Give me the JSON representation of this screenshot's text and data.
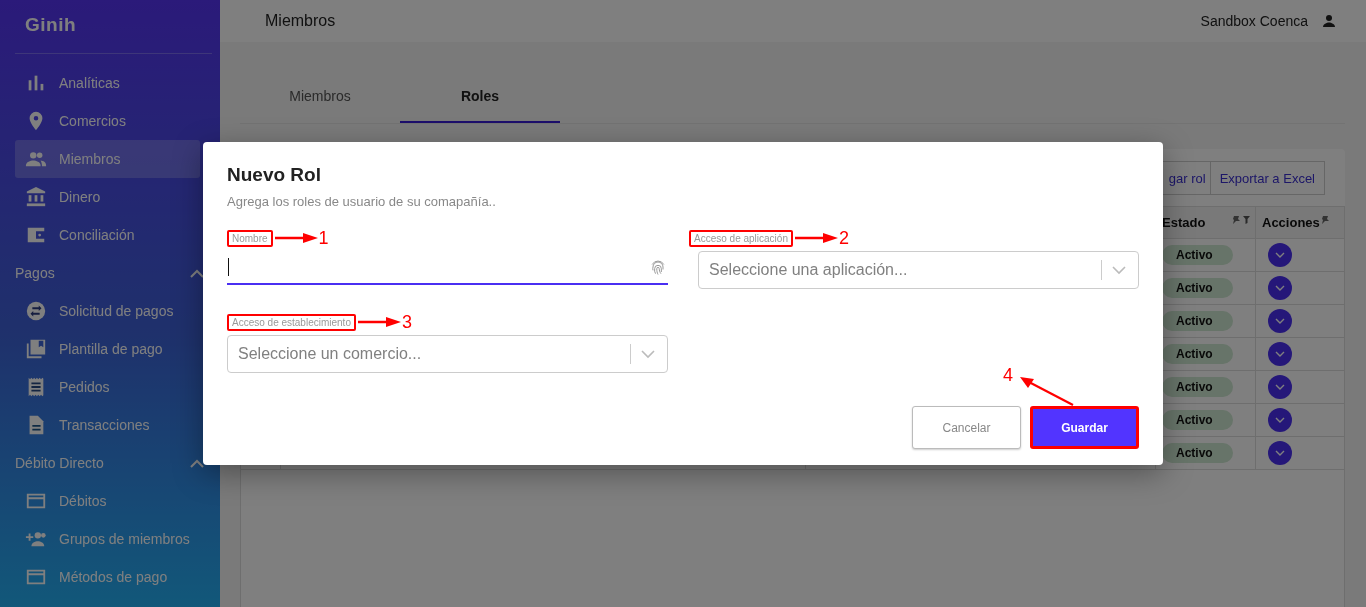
{
  "sidebar": {
    "logo": "Ginih",
    "groups": [
      {
        "items": [
          {
            "label": "Analíticas",
            "selected": false
          },
          {
            "label": "Comercios",
            "selected": false
          },
          {
            "label": "Miembros",
            "selected": true
          },
          {
            "label": "Dinero",
            "selected": false
          },
          {
            "label": "Conciliación",
            "selected": false
          }
        ]
      },
      {
        "title": "Pagos",
        "expanded": true,
        "items": [
          {
            "label": "Solicitud de pagos",
            "selected": false
          },
          {
            "label": "Plantilla de pago",
            "selected": false
          },
          {
            "label": "Pedidos",
            "selected": false
          },
          {
            "label": "Transacciones",
            "selected": false
          }
        ]
      },
      {
        "title": "Débito Directo",
        "expanded": true,
        "items": [
          {
            "label": "Débitos",
            "selected": false
          },
          {
            "label": "Grupos de miembros",
            "selected": false
          },
          {
            "label": "Métodos de pago",
            "selected": false
          }
        ]
      }
    ]
  },
  "header": {
    "title": "Miembros",
    "user": "Sandbox Coenca"
  },
  "tabs": [
    {
      "label": "Miembros",
      "selected": false
    },
    {
      "label": "Roles",
      "selected": true
    }
  ],
  "toolbar": [
    "gar rol",
    "Exportar a Excel"
  ],
  "table": {
    "columns": [
      "Estado",
      "Acciones"
    ],
    "rows": [
      {
        "status": "Activo"
      },
      {
        "status": "Activo"
      },
      {
        "status": "Activo"
      },
      {
        "status": "Activo"
      },
      {
        "status": "Activo"
      },
      {
        "status": "Activo"
      },
      {
        "status": "Activo"
      }
    ]
  },
  "dialog": {
    "title": "Nuevo Rol",
    "subtitle": "Agrega los roles de usuario de su comapañía..",
    "fields": [
      {
        "kind": "text",
        "label": "Nombre",
        "focused": true,
        "annotation": "1"
      },
      {
        "kind": "select",
        "label": "Acceso de aplicación",
        "placeholder": "Seleccione una aplicación...",
        "annotation": "2"
      },
      {
        "kind": "select",
        "label": "Acceso de establecimiento",
        "placeholder": "Seleccione un comercio...",
        "annotation": "3"
      }
    ],
    "buttons": [
      {
        "label": "Cancelar",
        "kind": "secondary"
      },
      {
        "label": "Guardar",
        "kind": "primary",
        "annotation": "4"
      }
    ]
  }
}
